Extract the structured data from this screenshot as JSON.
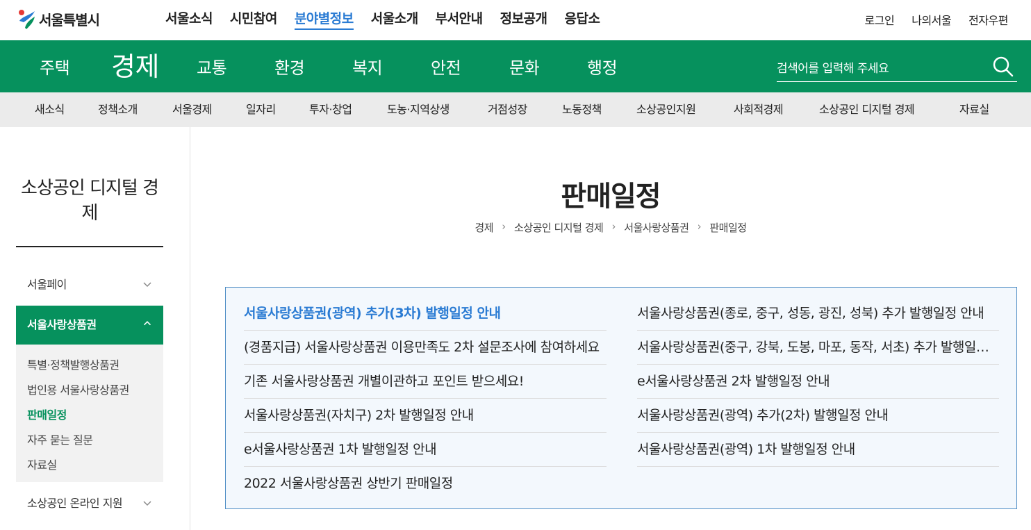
{
  "header": {
    "logo_text": "서울특별시",
    "gnb": [
      "서울소식",
      "시민참여",
      "분야별정보",
      "서울소개",
      "부서안내",
      "정보공개",
      "응답소"
    ],
    "gnb_active_index": 2,
    "util": [
      "로그인",
      "나의서울",
      "전자우편"
    ]
  },
  "green_nav": {
    "items": [
      "주택",
      "경제",
      "교통",
      "환경",
      "복지",
      "안전",
      "문화",
      "행정"
    ],
    "active_index": 1,
    "search_placeholder": "검색어를 입력해 주세요"
  },
  "sub_nav": {
    "items": [
      "새소식",
      "정책소개",
      "서울경제",
      "일자리",
      "투자·창업",
      "도농·지역상생",
      "거점성장",
      "노동정책",
      "소상공인지원",
      "사회적경제",
      "소상공인 디지털 경제",
      "자료실"
    ]
  },
  "sidebar": {
    "title": "소상공인 디지털 경제",
    "menu": {
      "item1": "서울페이",
      "item2": "서울사랑상품권",
      "item3": "소상공인 온라인 지원"
    },
    "submenu": [
      "특별·정책발행상품권",
      "법인용 서울사랑상품권",
      "판매일정",
      "자주 묻는 질문",
      "자료실"
    ],
    "submenu_current_index": 2
  },
  "main": {
    "title": "판매일정",
    "breadcrumb": [
      "경제",
      "소상공인 디지털 경제",
      "서울사랑상품권",
      "판매일정"
    ],
    "links_left": [
      "서울사랑상품권(광역) 추가(3차) 발행일정 안내",
      "(경품지급) 서울사랑상품권 이용만족도 2차 설문조사에 참여하세요",
      "기존 서울사랑상품권 개별이관하고 포인트 받으세요!",
      "서울사랑상품권(자치구) 2차 발행일정 안내",
      "e서울사랑상품권 1차 발행일정 안내",
      "2022 서울사랑상품권 상반기 판매일정"
    ],
    "links_right": [
      "서울사랑상품권(종로, 중구, 성동, 광진, 성북) 추가 발행일정 안내",
      "서울사랑상품권(중구, 강북, 도봉, 마포, 동작, 서초) 추가 발행일정 안내",
      "e서울사랑상품권 2차 발행일정 안내",
      "서울사랑상품권(광역) 추가(2차) 발행일정 안내",
      "서울사랑상품권(광역) 1차 발행일정 안내"
    ]
  },
  "colors": {
    "brand_green": "#06915d",
    "link_blue": "#2a7bd3",
    "box_border": "#4d8cc4",
    "box_bg": "#f3f8fd"
  }
}
